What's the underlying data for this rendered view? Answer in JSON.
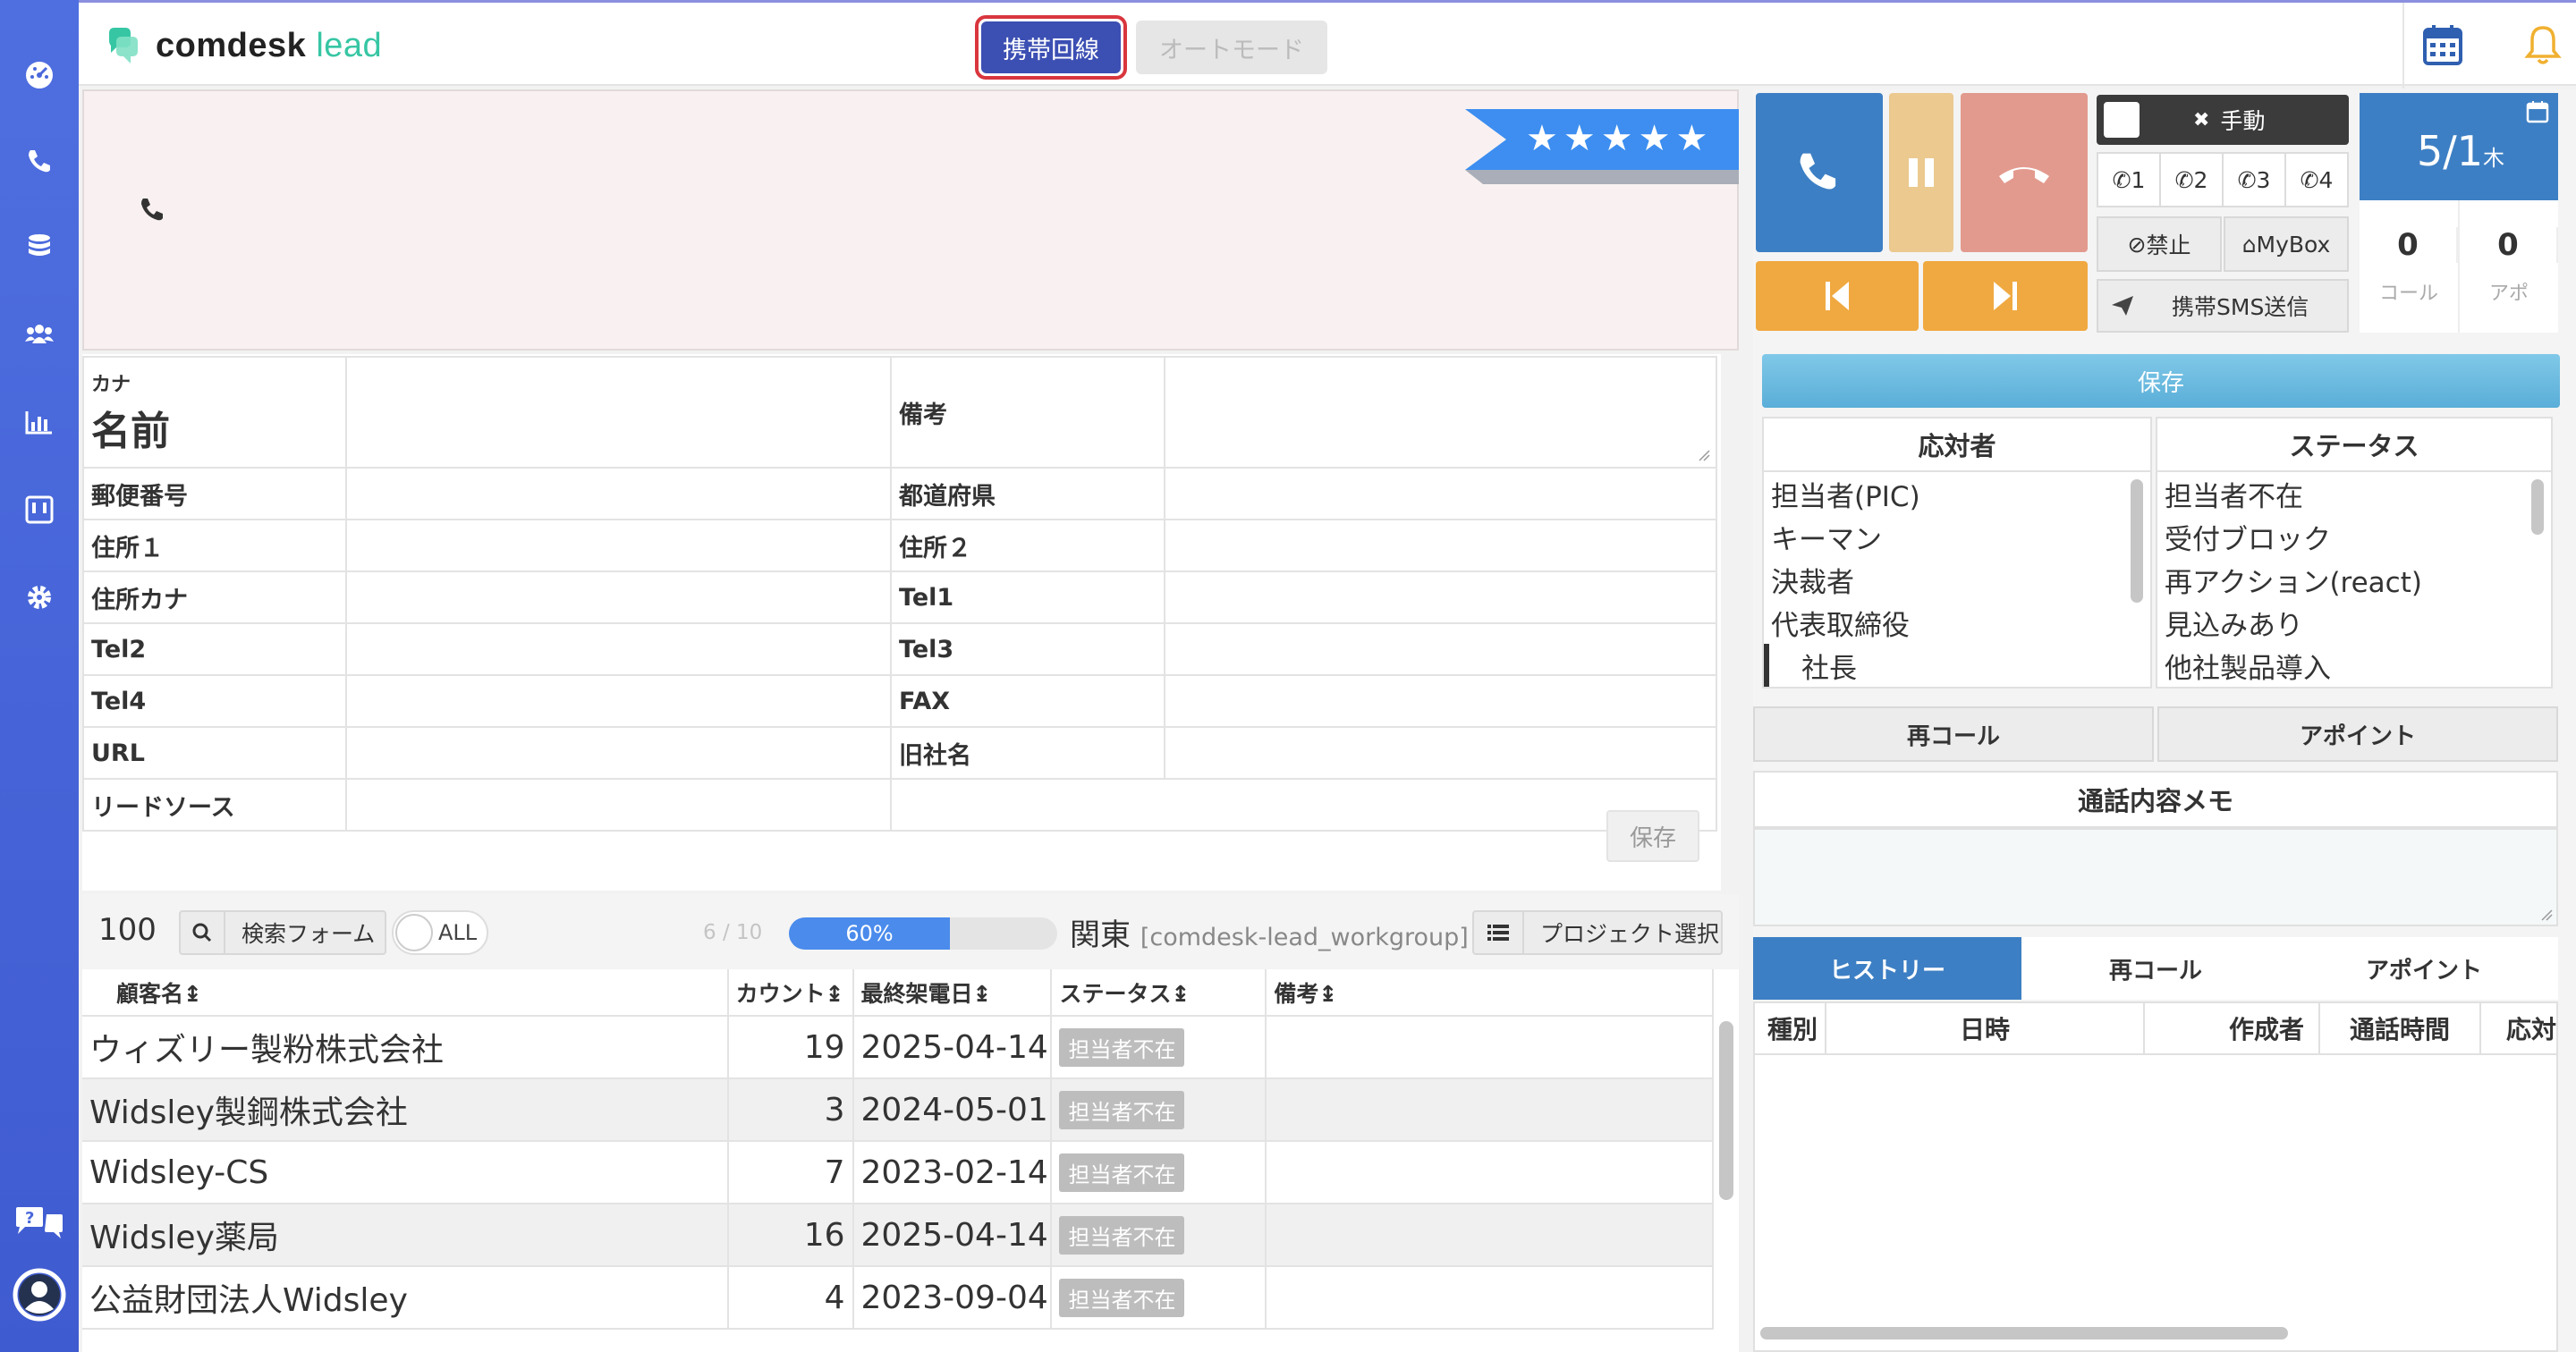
{
  "app": {
    "logo_main": "comdesk",
    "logo_accent": "lead"
  },
  "topbar": {
    "mobile_line_label": "携帯回線",
    "auto_mode_label": "オートモード"
  },
  "lead": {
    "rating_stars": "★★★★★",
    "rating_value": 5
  },
  "info": {
    "kana_label": "カナ",
    "name_label": "名前",
    "remarks_label": "備考",
    "postal_label": "郵便番号",
    "prefecture_label": "都道府県",
    "address1_label": "住所１",
    "address2_label": "住所２",
    "address_kana_label": "住所カナ",
    "tel1_label": "Tel1",
    "tel2_label": "Tel2",
    "tel3_label": "Tel3",
    "tel4_label": "Tel4",
    "fax_label": "FAX",
    "url_label": "URL",
    "old_company_label": "旧社名",
    "lead_source_label": "リードソース",
    "save_label": "保存"
  },
  "list_toolbar": {
    "count": "100",
    "search_form_label": "検索フォーム",
    "toggle_label": "ALL",
    "page": "6 / 10",
    "progress_label": "60%",
    "progress_value": 0.6,
    "region": "関東",
    "workgroup": "[comdesk-lead_workgroup]",
    "project_select_label": "プロジェクト選択"
  },
  "list": {
    "columns": [
      "顧客名↨",
      "カウント↨",
      "最終架電日↨",
      "ステータス↨",
      "備考↨"
    ],
    "rows": [
      {
        "name": "ウィズリー製粉株式会社",
        "count": "19",
        "date": "2025-04-14",
        "status": "担当者不在",
        "note": ""
      },
      {
        "name": "Widsley製鋼株式会社",
        "count": "3",
        "date": "2024-05-01",
        "status": "担当者不在",
        "note": ""
      },
      {
        "name": "Widsley-CS",
        "count": "7",
        "date": "2023-02-14",
        "status": "担当者不在",
        "note": ""
      },
      {
        "name": "Widsley薬局",
        "count": "16",
        "date": "2025-04-14",
        "status": "担当者不在",
        "note": ""
      },
      {
        "name": "公益財団法人Widsley",
        "count": "4",
        "date": "2023-09-04",
        "status": "担当者不在",
        "note": ""
      }
    ]
  },
  "call_panel": {
    "manual_label": "手動",
    "lines": [
      "1",
      "2",
      "3",
      "4"
    ],
    "ban_label": "禁止",
    "mybox_label": "MyBox",
    "sms_label": "携帯SMS送信",
    "date": "5/1",
    "weekday": "木",
    "calls_count": "0",
    "calls_label": "コール",
    "appo_count": "0",
    "appo_label": "アポ"
  },
  "right": {
    "save_label": "保存",
    "responder_title": "応対者",
    "responders": [
      "担当者(PIC)",
      "キーマン",
      "決裁者",
      "代表取締役",
      "社長"
    ],
    "status_title": "ステータス",
    "statuses": [
      "担当者不在",
      "受付ブロック",
      "再アクション(react)",
      "見込みあり",
      "他社製品導入"
    ],
    "recall_label": "再コール",
    "appoint_label": "アポイント",
    "memo_title": "通話内容メモ",
    "history_tabs": [
      "ヒストリー",
      "再コール",
      "アポイント"
    ],
    "history_columns": [
      "種別",
      "日時",
      "作成者",
      "通話時間",
      "応対"
    ]
  },
  "colors": {
    "sidebar": "#4a68db",
    "primary_blue": "#3d7fc4",
    "mobile_button": "#3c4fb3",
    "highlight_border": "#d9363e",
    "call_orange": "#f0a940"
  }
}
